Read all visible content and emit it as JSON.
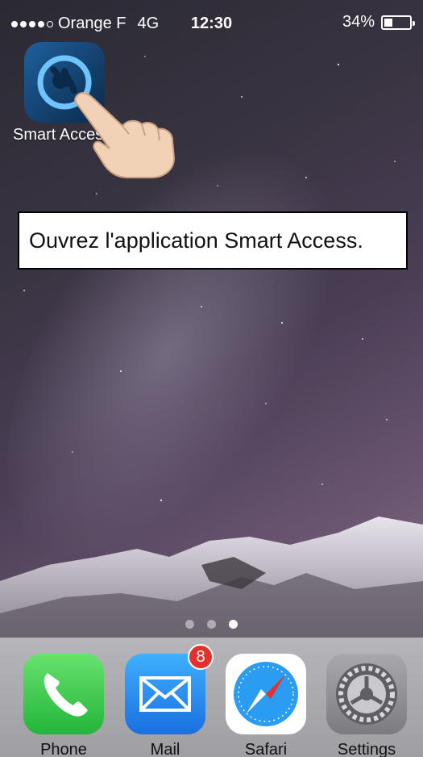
{
  "status_bar": {
    "carrier": "Orange F",
    "network": "4G",
    "time": "12:30",
    "battery_text": "34%",
    "battery_level": 0.34,
    "signal_bars_filled": 4
  },
  "home_app": {
    "label": "Smart Access",
    "icon": "smart-access-icon"
  },
  "instruction": {
    "text": "Ouvrez l'application Smart Access."
  },
  "page_indicator": {
    "count": 3,
    "active": 3
  },
  "dock": {
    "apps": [
      {
        "label": "Phone",
        "icon": "phone-icon",
        "color": "#3ed54c"
      },
      {
        "label": "Mail",
        "icon": "mail-icon",
        "color": "#2b8ef0",
        "badge": "8"
      },
      {
        "label": "Safari",
        "icon": "safari-icon",
        "color": "#2a9cf2"
      },
      {
        "label": "Settings",
        "icon": "settings-gear-icon",
        "color": "#8e8e93"
      }
    ]
  }
}
